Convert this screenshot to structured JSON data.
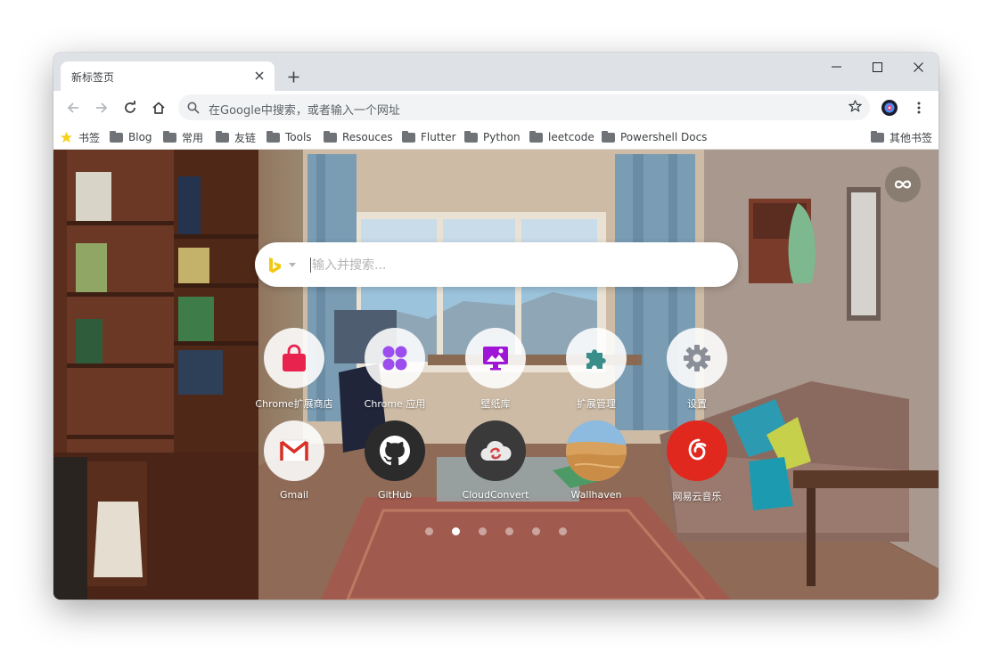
{
  "tab": {
    "title": "新标签页"
  },
  "toolbar": {
    "omnibox_placeholder": "在Google中搜索，或者输入一个网址"
  },
  "bookmarks": {
    "star_label": "书签",
    "items": [
      "Blog",
      "常用",
      "友链",
      "Tools",
      "Resouces",
      "Flutter",
      "Python",
      "leetcode",
      "Powershell Docs"
    ],
    "other": "其他书签"
  },
  "newtab": {
    "search_placeholder": "输入并搜索...",
    "search_engine_icon": "bing-icon",
    "tiles": [
      {
        "label": "Chrome扩展商店",
        "icon": "shopping-bag-icon",
        "color": "#e8234e"
      },
      {
        "label": "Chrome 应用",
        "icon": "apps-grid-icon",
        "color": "#9b4dee"
      },
      {
        "label": "壁纸库",
        "icon": "wallpaper-icon",
        "color": "#a016d6"
      },
      {
        "label": "扩展管理",
        "icon": "puzzle-icon",
        "color": "#3a8e8a"
      },
      {
        "label": "设置",
        "icon": "gear-icon",
        "color": "#8a8f97"
      },
      {
        "label": "Gmail",
        "icon": "gmail-icon",
        "color": "#d93025"
      },
      {
        "label": "GitHub",
        "icon": "github-icon",
        "color": "#333333"
      },
      {
        "label": "CloudConvert",
        "icon": "cloudconvert-icon",
        "color": "#d64040"
      },
      {
        "label": "Wallhaven",
        "icon": "desert-icon",
        "color": "#d29a55"
      },
      {
        "label": "网易云音乐",
        "icon": "netease-music-icon",
        "color": "#e0281e"
      }
    ],
    "pages": 6,
    "active_page": 2
  }
}
